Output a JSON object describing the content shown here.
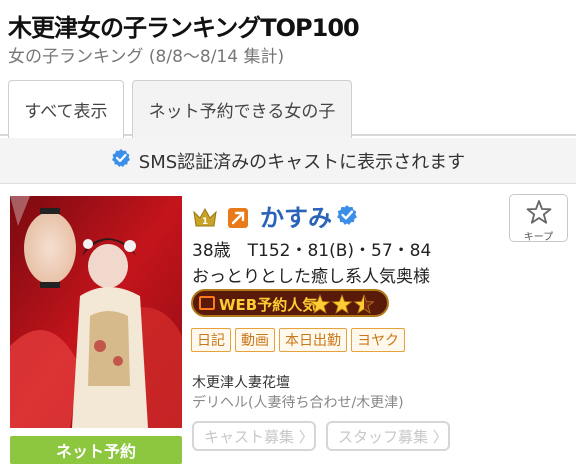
{
  "header": {
    "title": "木更津女の子ランキングTOP100",
    "subtitle": "女の子ランキング (8/8〜8/14 集計)"
  },
  "tabs": [
    {
      "label": "すべて表示",
      "active": true
    },
    {
      "label": "ネット予約できる女の子",
      "active": false
    }
  ],
  "notice": {
    "text": "SMS認証済みのキャストに表示されます",
    "icon": "verified-check-icon"
  },
  "cast": {
    "rank": "1",
    "trend": "up-right-arrow-icon",
    "name": "かすみ",
    "verified": true,
    "specs": "38歳　T152・81(B)・57・84",
    "catchphrase": "おっとりとした癒し系人気奥様",
    "web_badge": {
      "label": "WEB予約人気",
      "rating": 2.5
    },
    "tags": [
      "日記",
      "動画",
      "本日出勤",
      "ヨヤク"
    ],
    "shop_name": "木更津人妻花壇",
    "shop_type": "デリヘル(人妻待ち合わせ/木更津)",
    "reserve_label": "ネット予約",
    "keep_label": "キープ",
    "recruit_buttons": [
      "キャスト募集 〉",
      "スタッフ募集 〉"
    ]
  },
  "colors": {
    "name": "#2a63b8",
    "reserve": "#8dc63f",
    "tag_border": "#e6a23c",
    "verified": "#3b8fe8",
    "badge_bg": "#5a1a0a"
  }
}
